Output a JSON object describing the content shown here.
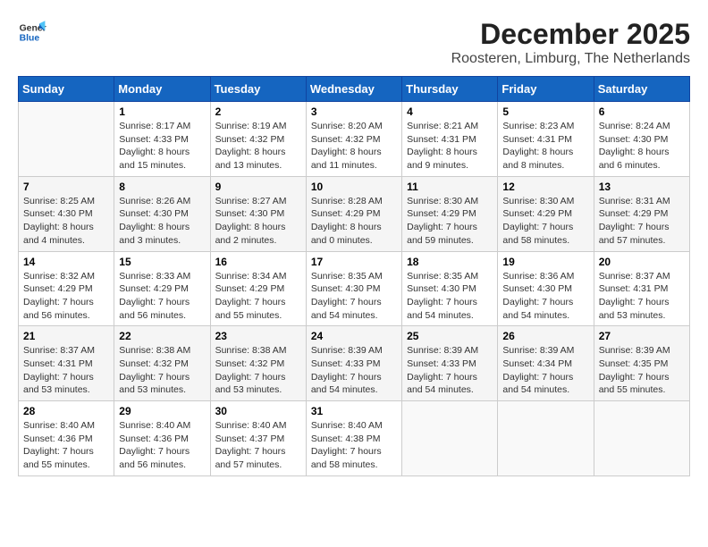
{
  "header": {
    "logo_line1": "General",
    "logo_line2": "Blue",
    "month": "December 2025",
    "location": "Roosteren, Limburg, The Netherlands"
  },
  "days_of_week": [
    "Sunday",
    "Monday",
    "Tuesday",
    "Wednesday",
    "Thursday",
    "Friday",
    "Saturday"
  ],
  "weeks": [
    [
      {
        "day": "",
        "info": ""
      },
      {
        "day": "1",
        "info": "Sunrise: 8:17 AM\nSunset: 4:33 PM\nDaylight: 8 hours\nand 15 minutes."
      },
      {
        "day": "2",
        "info": "Sunrise: 8:19 AM\nSunset: 4:32 PM\nDaylight: 8 hours\nand 13 minutes."
      },
      {
        "day": "3",
        "info": "Sunrise: 8:20 AM\nSunset: 4:32 PM\nDaylight: 8 hours\nand 11 minutes."
      },
      {
        "day": "4",
        "info": "Sunrise: 8:21 AM\nSunset: 4:31 PM\nDaylight: 8 hours\nand 9 minutes."
      },
      {
        "day": "5",
        "info": "Sunrise: 8:23 AM\nSunset: 4:31 PM\nDaylight: 8 hours\nand 8 minutes."
      },
      {
        "day": "6",
        "info": "Sunrise: 8:24 AM\nSunset: 4:30 PM\nDaylight: 8 hours\nand 6 minutes."
      }
    ],
    [
      {
        "day": "7",
        "info": "Sunrise: 8:25 AM\nSunset: 4:30 PM\nDaylight: 8 hours\nand 4 minutes."
      },
      {
        "day": "8",
        "info": "Sunrise: 8:26 AM\nSunset: 4:30 PM\nDaylight: 8 hours\nand 3 minutes."
      },
      {
        "day": "9",
        "info": "Sunrise: 8:27 AM\nSunset: 4:30 PM\nDaylight: 8 hours\nand 2 minutes."
      },
      {
        "day": "10",
        "info": "Sunrise: 8:28 AM\nSunset: 4:29 PM\nDaylight: 8 hours\nand 0 minutes."
      },
      {
        "day": "11",
        "info": "Sunrise: 8:30 AM\nSunset: 4:29 PM\nDaylight: 7 hours\nand 59 minutes."
      },
      {
        "day": "12",
        "info": "Sunrise: 8:30 AM\nSunset: 4:29 PM\nDaylight: 7 hours\nand 58 minutes."
      },
      {
        "day": "13",
        "info": "Sunrise: 8:31 AM\nSunset: 4:29 PM\nDaylight: 7 hours\nand 57 minutes."
      }
    ],
    [
      {
        "day": "14",
        "info": "Sunrise: 8:32 AM\nSunset: 4:29 PM\nDaylight: 7 hours\nand 56 minutes."
      },
      {
        "day": "15",
        "info": "Sunrise: 8:33 AM\nSunset: 4:29 PM\nDaylight: 7 hours\nand 56 minutes."
      },
      {
        "day": "16",
        "info": "Sunrise: 8:34 AM\nSunset: 4:29 PM\nDaylight: 7 hours\nand 55 minutes."
      },
      {
        "day": "17",
        "info": "Sunrise: 8:35 AM\nSunset: 4:30 PM\nDaylight: 7 hours\nand 54 minutes."
      },
      {
        "day": "18",
        "info": "Sunrise: 8:35 AM\nSunset: 4:30 PM\nDaylight: 7 hours\nand 54 minutes."
      },
      {
        "day": "19",
        "info": "Sunrise: 8:36 AM\nSunset: 4:30 PM\nDaylight: 7 hours\nand 54 minutes."
      },
      {
        "day": "20",
        "info": "Sunrise: 8:37 AM\nSunset: 4:31 PM\nDaylight: 7 hours\nand 53 minutes."
      }
    ],
    [
      {
        "day": "21",
        "info": "Sunrise: 8:37 AM\nSunset: 4:31 PM\nDaylight: 7 hours\nand 53 minutes."
      },
      {
        "day": "22",
        "info": "Sunrise: 8:38 AM\nSunset: 4:32 PM\nDaylight: 7 hours\nand 53 minutes."
      },
      {
        "day": "23",
        "info": "Sunrise: 8:38 AM\nSunset: 4:32 PM\nDaylight: 7 hours\nand 53 minutes."
      },
      {
        "day": "24",
        "info": "Sunrise: 8:39 AM\nSunset: 4:33 PM\nDaylight: 7 hours\nand 54 minutes."
      },
      {
        "day": "25",
        "info": "Sunrise: 8:39 AM\nSunset: 4:33 PM\nDaylight: 7 hours\nand 54 minutes."
      },
      {
        "day": "26",
        "info": "Sunrise: 8:39 AM\nSunset: 4:34 PM\nDaylight: 7 hours\nand 54 minutes."
      },
      {
        "day": "27",
        "info": "Sunrise: 8:39 AM\nSunset: 4:35 PM\nDaylight: 7 hours\nand 55 minutes."
      }
    ],
    [
      {
        "day": "28",
        "info": "Sunrise: 8:40 AM\nSunset: 4:36 PM\nDaylight: 7 hours\nand 55 minutes."
      },
      {
        "day": "29",
        "info": "Sunrise: 8:40 AM\nSunset: 4:36 PM\nDaylight: 7 hours\nand 56 minutes."
      },
      {
        "day": "30",
        "info": "Sunrise: 8:40 AM\nSunset: 4:37 PM\nDaylight: 7 hours\nand 57 minutes."
      },
      {
        "day": "31",
        "info": "Sunrise: 8:40 AM\nSunset: 4:38 PM\nDaylight: 7 hours\nand 58 minutes."
      },
      {
        "day": "",
        "info": ""
      },
      {
        "day": "",
        "info": ""
      },
      {
        "day": "",
        "info": ""
      }
    ]
  ]
}
